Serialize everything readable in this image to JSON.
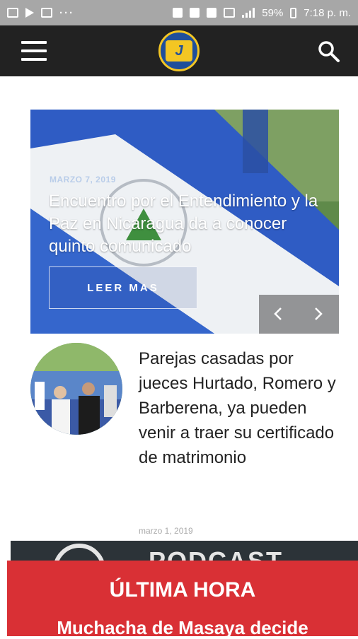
{
  "status_bar": {
    "battery": "59%",
    "time": "7:18 p. m.",
    "overflow": "···"
  },
  "app_bar": {
    "logo_text": "J",
    "icons": [
      "menu-icon",
      "logo",
      "search-icon"
    ]
  },
  "hero": {
    "date": "MARZO 7, 2019",
    "title": "Encuentro por el Entendimiento y la Paz en Nicaragua da a conocer quinto comunicado",
    "button_label": "LEER MAS"
  },
  "article": {
    "title": "Parejas casadas por jueces Hurtado, Romero y Barberena, ya pueden venir a traer su certificado de matrimonio",
    "date": "marzo 1, 2019"
  },
  "banner": {
    "text": "PODCAST"
  },
  "breaking": {
    "label": "ÚLTIMA HORA",
    "headline": "Muchacha de Masaya decide"
  },
  "colors": {
    "app_bar": "#222222",
    "breaking": "#d93035",
    "flag_blue": "#2f5cc4",
    "logo_yellow": "#f3c623"
  }
}
